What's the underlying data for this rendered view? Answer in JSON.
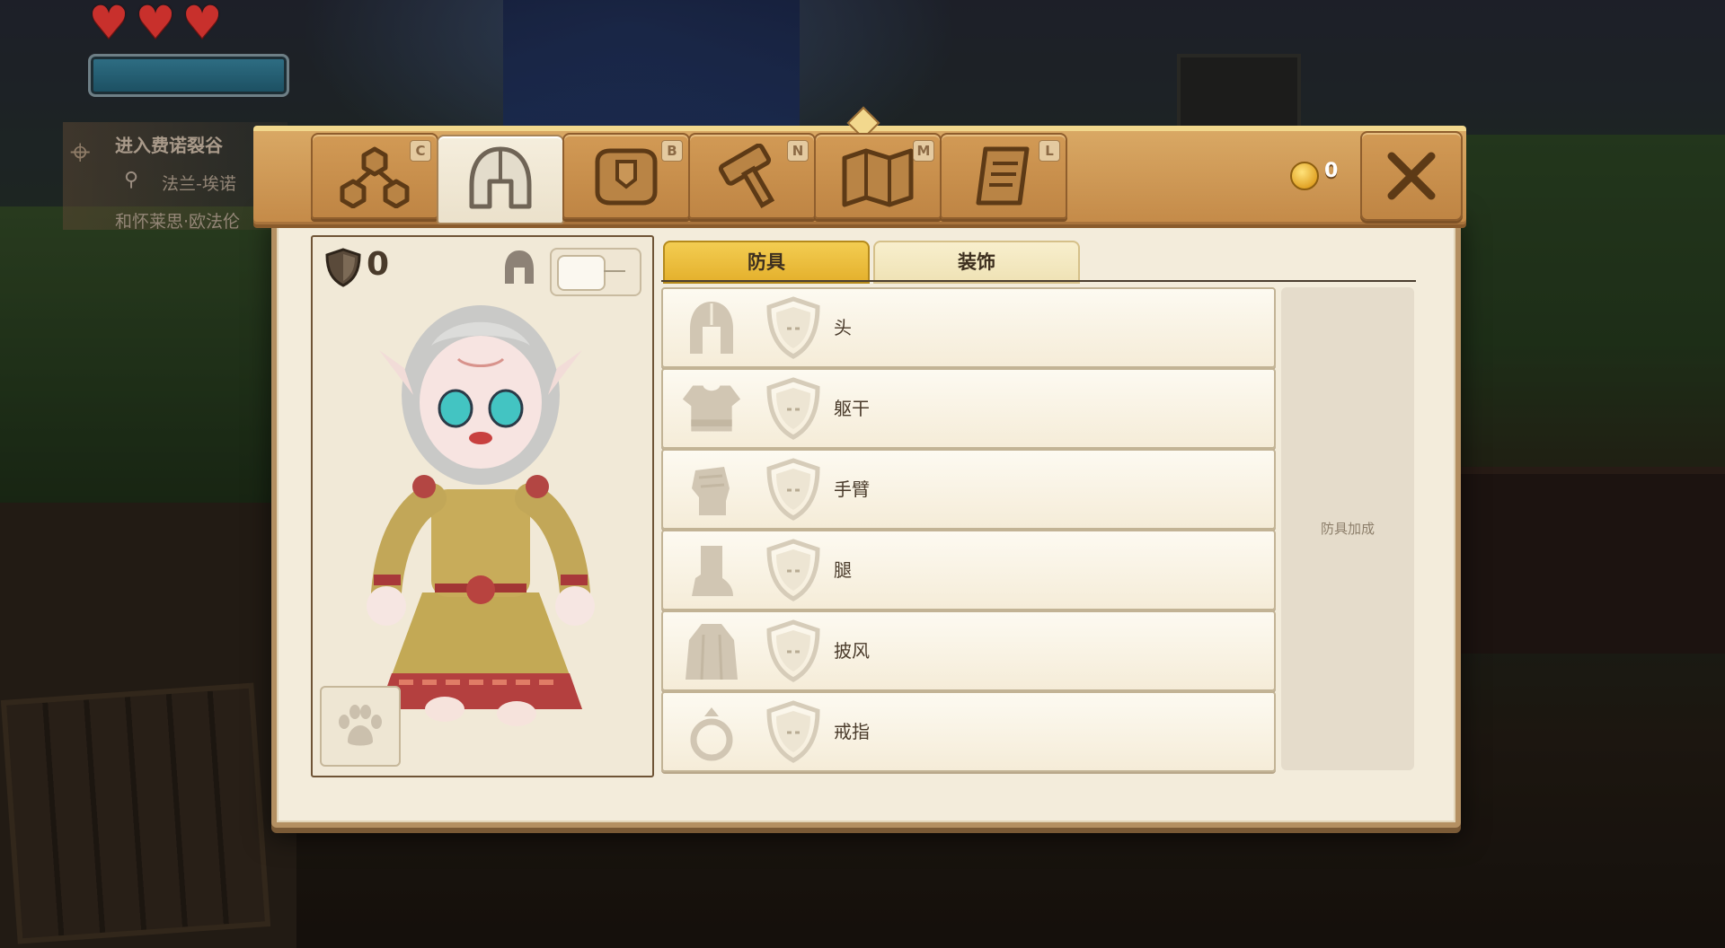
{
  "hud": {
    "hearts": 3,
    "quest": {
      "title": "进入费诺裂谷",
      "location": "法兰-埃诺",
      "subtitle": "和怀莱思·欧法伦"
    }
  },
  "toolbar": {
    "tabs": [
      {
        "name": "skills",
        "icon": "skill-tree-icon",
        "key": "C"
      },
      {
        "name": "equipment",
        "icon": "helmet-icon",
        "key": ""
      },
      {
        "name": "inventory",
        "icon": "backpack-icon",
        "key": "B"
      },
      {
        "name": "crafting",
        "icon": "hammer-icon",
        "key": "N"
      },
      {
        "name": "map",
        "icon": "map-icon",
        "key": "M"
      },
      {
        "name": "quests",
        "icon": "scroll-icon",
        "key": "L"
      }
    ],
    "coins": "0",
    "close_icon": "close-icon"
  },
  "character": {
    "armor_value": "0"
  },
  "equipment": {
    "subtabs": {
      "armor": "防具",
      "decoration": "装饰"
    },
    "active_subtab": "armor",
    "slots": [
      {
        "label": "头",
        "icon": "helmet-icon"
      },
      {
        "label": "躯干",
        "icon": "chest-armor-icon"
      },
      {
        "label": "手臂",
        "icon": "gauntlet-icon"
      },
      {
        "label": "腿",
        "icon": "boot-icon"
      },
      {
        "label": "披风",
        "icon": "cape-icon"
      },
      {
        "label": "戒指",
        "icon": "ring-icon"
      }
    ],
    "bonus_label": "防具加成"
  },
  "colors": {
    "accent": "#f3cd52",
    "panel": "#f3ecdb",
    "frame": "#c48a48"
  }
}
